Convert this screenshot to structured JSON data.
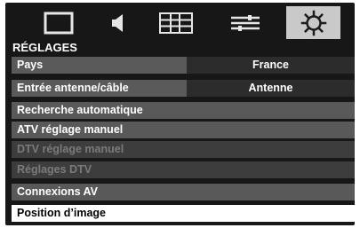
{
  "menu": {
    "title": "RÉGLAGES",
    "icons": [
      {
        "name": "picture-icon",
        "selected": false
      },
      {
        "name": "sound-icon",
        "selected": false
      },
      {
        "name": "list-icon",
        "selected": false
      },
      {
        "name": "sliders-icon",
        "selected": false
      },
      {
        "name": "gear-icon",
        "selected": true
      }
    ],
    "rows": [
      {
        "label": "Pays",
        "value": "France",
        "state": "enabled"
      },
      {
        "label": "Entrée antenne/câble",
        "value": "Antenne",
        "state": "enabled"
      },
      {
        "label": "Recherche automatique",
        "state": "enabled"
      },
      {
        "label": "ATV réglage manuel",
        "state": "enabled"
      },
      {
        "label": "DTV réglage manuel",
        "state": "disabled"
      },
      {
        "label": "Réglages DTV",
        "state": "disabled"
      },
      {
        "label": "Connexions AV",
        "state": "enabled"
      },
      {
        "label": "Position d’image",
        "state": "selected"
      }
    ]
  },
  "colors": {
    "panel": "#171717",
    "row_enabled": "#595959",
    "row_disabled": "#3d3d3d",
    "value_bg": "#2c2c2c",
    "selected_row": "#ffffff",
    "selected_tab": "#c9c9c9"
  }
}
